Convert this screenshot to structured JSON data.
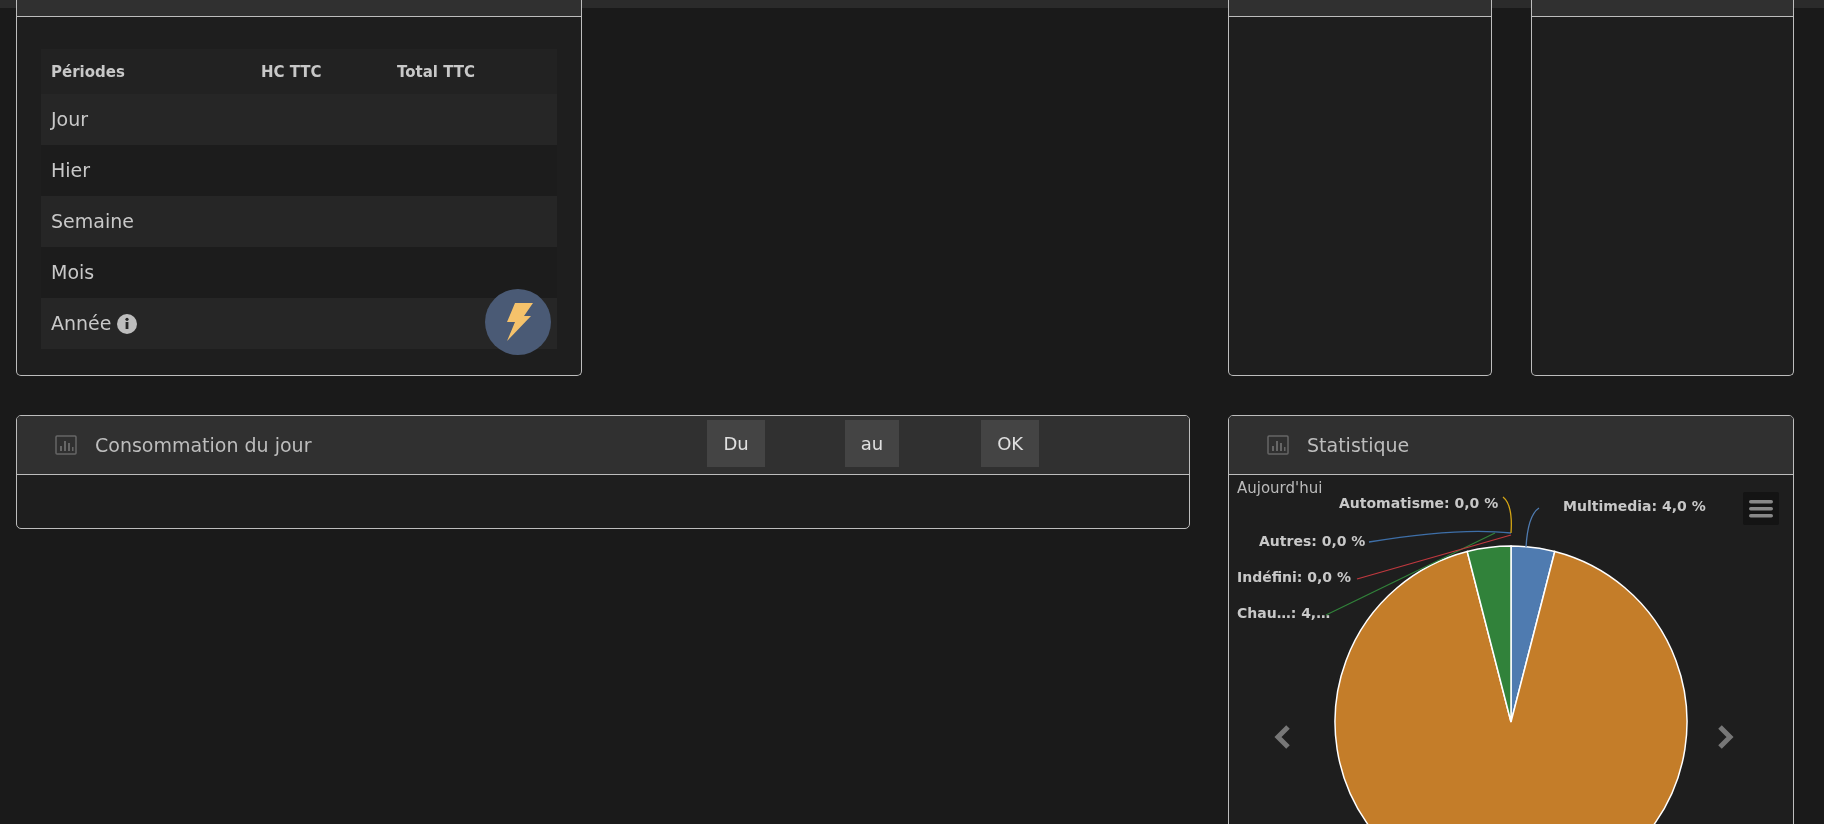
{
  "periods_panel": {
    "table": {
      "columns": [
        "Périodes",
        "HC TTC",
        "Total TTC"
      ],
      "rows": [
        {
          "label": "Jour",
          "info": false
        },
        {
          "label": "Hier",
          "info": false
        },
        {
          "label": "Semaine",
          "info": false
        },
        {
          "label": "Mois",
          "info": false
        },
        {
          "label": "Année",
          "info": true
        }
      ]
    }
  },
  "consumption_panel": {
    "title": "Consommation du jour",
    "buttons": [
      "Du",
      "au",
      "OK"
    ]
  },
  "statistics_panel": {
    "title": "Statistique",
    "chart_data": {
      "type": "pie",
      "title": "Aujourd'hui",
      "values": [
        4.0,
        92.0,
        4.0,
        0.0,
        0.0,
        0.0
      ],
      "colors": [
        "#4f7bb0",
        "#c47d29",
        "#31823a",
        "#c0393f",
        "#3e6fa8",
        "#d4a514"
      ],
      "value_labels": [
        "Multimedia: 4,0 %",
        null,
        "Chau…: 4,…",
        "Indéfini: 0,0 %",
        "Autres: 0,0 %",
        "Automatisme: 0,0 %"
      ]
    }
  }
}
